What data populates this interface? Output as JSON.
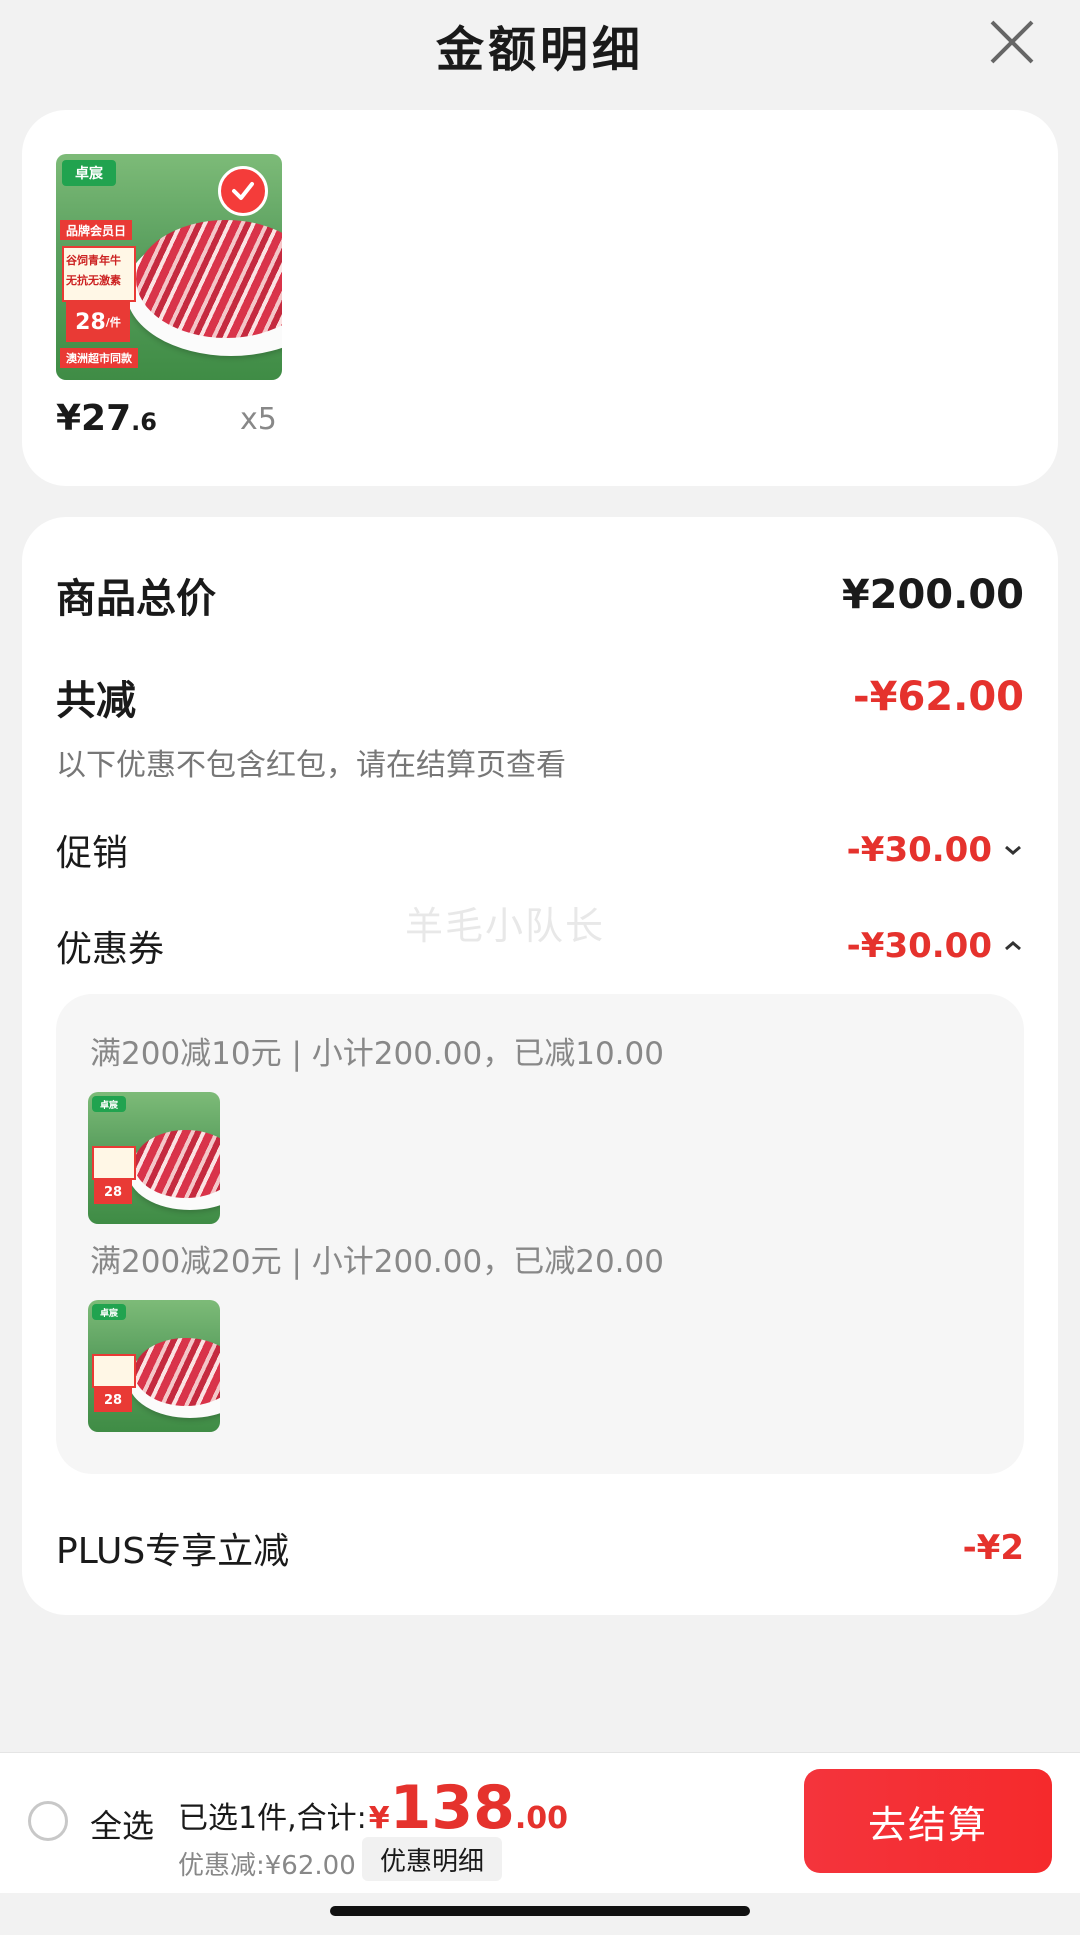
{
  "header": {
    "title": "金额明细",
    "close_icon": "close-icon"
  },
  "product": {
    "thumb": {
      "brand": "卓宸",
      "promo": "品牌会员日",
      "line1": "谷饲青年牛",
      "line2": "无抗无激素",
      "price": "28",
      "unit": "/件",
      "footer": "澳洲超市同款"
    },
    "price_int": "¥27",
    "price_dec": ".6",
    "qty": "x5",
    "selected": true
  },
  "summary": {
    "total_label": "商品总价",
    "total_value": "¥200.00",
    "reduce_label": "共减",
    "reduce_value": "-¥62.00",
    "note": "以下优惠不包含红包，请在结算页查看",
    "promo_label": "促销",
    "promo_value": "-¥30.00",
    "coupon_label": "优惠券",
    "coupon_value": "-¥30.00",
    "coupons": [
      {
        "text": "满200减10元 | 小计200.00，已减10.00"
      },
      {
        "text": "满200减20元 | 小计200.00，已减20.00"
      }
    ],
    "plus_label": "PLUS专享立减",
    "plus_value": "-¥2"
  },
  "watermark": "羊毛小队长",
  "bottom": {
    "select_all": "全选",
    "selected_text": "已选1件,合计:",
    "yen": "¥",
    "amount_int": "138",
    "amount_dec": ".00",
    "discount": "优惠减:¥62.00",
    "detail_button": "优惠明细",
    "checkout_button": "去结算"
  },
  "colors": {
    "accent": "#e5322d",
    "checkout_bg": "#f4343c",
    "brand_green": "#21a34f"
  }
}
